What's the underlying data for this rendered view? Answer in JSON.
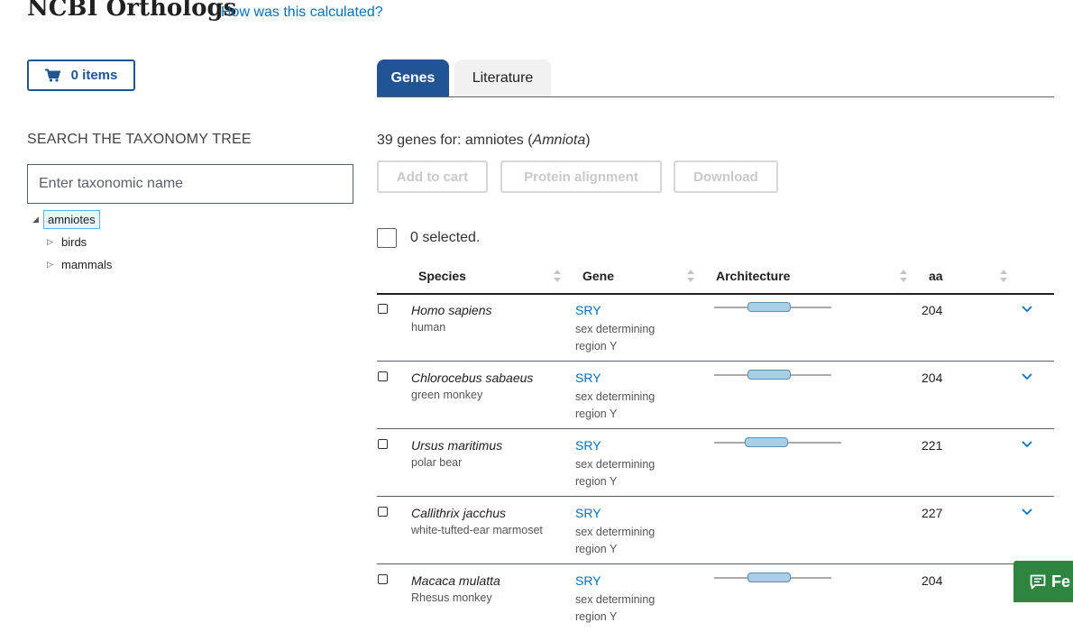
{
  "header": {
    "title": "NCBI Orthologs",
    "calc_link": "How was this calculated?"
  },
  "cart": {
    "label": "0 items"
  },
  "taxonomy": {
    "heading": "SEARCH THE TAXONOMY TREE",
    "search_placeholder": "Enter taxonomic name",
    "tree": [
      {
        "label": "amniotes",
        "expanded": true,
        "selected": true
      },
      {
        "label": "birds",
        "expanded": false
      },
      {
        "label": "mammals",
        "expanded": false
      }
    ]
  },
  "tabs": [
    {
      "label": "Genes",
      "active": true
    },
    {
      "label": "Literature",
      "active": false
    }
  ],
  "results": {
    "count_prefix": "39 genes for: ",
    "taxon_common": "amniotes",
    "taxon_open": " (",
    "taxon_scientific": "Amniota",
    "taxon_close": ")",
    "buttons": {
      "add_to_cart": "Add to cart",
      "protein_alignment": "Protein alignment",
      "download": "Download"
    },
    "selected_text": "0 selected.",
    "columns": {
      "species": "Species",
      "gene": "Gene",
      "architecture": "Architecture",
      "aa": "aa"
    },
    "rows": [
      {
        "species": "Homo sapiens",
        "common": "human",
        "gene": "SRY",
        "desc1": "sex determining",
        "desc2": "region Y",
        "aa": "204"
      },
      {
        "species": "Chlorocebus sabaeus",
        "common": "green monkey",
        "gene": "SRY",
        "desc1": "sex determining",
        "desc2": "region Y",
        "aa": "204"
      },
      {
        "species": "Ursus maritimus",
        "common": "polar bear",
        "gene": "SRY",
        "desc1": "sex determining",
        "desc2": "region Y",
        "aa": "221"
      },
      {
        "species": "Callithrix jacchus",
        "common": "white-tufted-ear marmoset",
        "gene": "SRY",
        "desc1": "sex determining",
        "desc2": "region Y",
        "aa": "227"
      },
      {
        "species": "Macaca mulatta",
        "common": "Rhesus monkey",
        "gene": "SRY",
        "desc1": "sex determining",
        "desc2": "region Y",
        "aa": "204"
      }
    ]
  },
  "feedback": {
    "label": "Fe"
  },
  "colors": {
    "primary": "#205493",
    "link": "#0071bc",
    "domain_fill": "#a7cfe5",
    "feedback": "#2e8540"
  }
}
